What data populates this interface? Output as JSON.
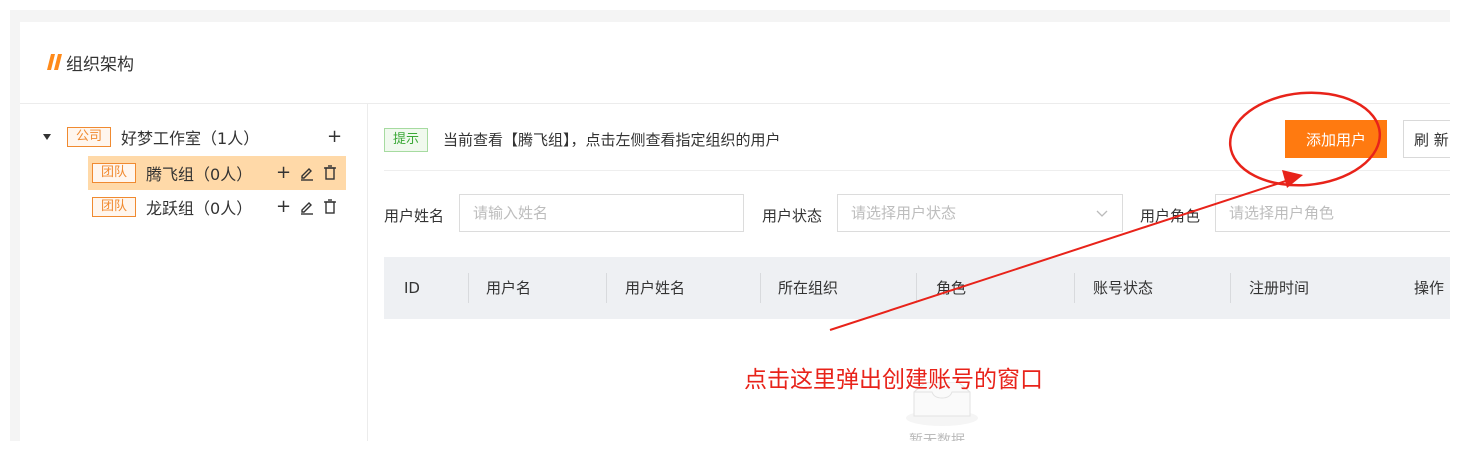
{
  "header": {
    "title": "组织架构"
  },
  "tree": {
    "root": {
      "tag": "公司",
      "label": "好梦工作室（1人）",
      "add_icon": "plus-icon"
    },
    "children": [
      {
        "tag": "团队",
        "label": "腾飞组（0人）",
        "selected": true
      },
      {
        "tag": "团队",
        "label": "龙跃组（0人）",
        "selected": false
      }
    ]
  },
  "hint": {
    "tag": "提示",
    "text": "当前查看【腾飞组】，点击左侧查看指定组织的用户"
  },
  "toolbar": {
    "add_user_label": "添加用户",
    "refresh_label": "刷 新"
  },
  "filters": {
    "name_label": "用户姓名",
    "name_placeholder": "请输入姓名",
    "status_label": "用户状态",
    "status_placeholder": "请选择用户状态",
    "role_label": "用户角色",
    "role_placeholder": "请选择用户角色"
  },
  "table": {
    "columns": [
      "ID",
      "用户名",
      "用户姓名",
      "所在组织",
      "角色",
      "账号状态",
      "注册时间",
      "操作"
    ],
    "empty_text": "暂无数据"
  },
  "annotation": {
    "text": "点击这里弹出创建账号的窗口",
    "color": "#e8231a"
  },
  "colors": {
    "accent": "#ff7a10",
    "tag_orange": "#f08a30",
    "selected_bg": "#ffd9a8",
    "hint_green": "#3aa836"
  }
}
